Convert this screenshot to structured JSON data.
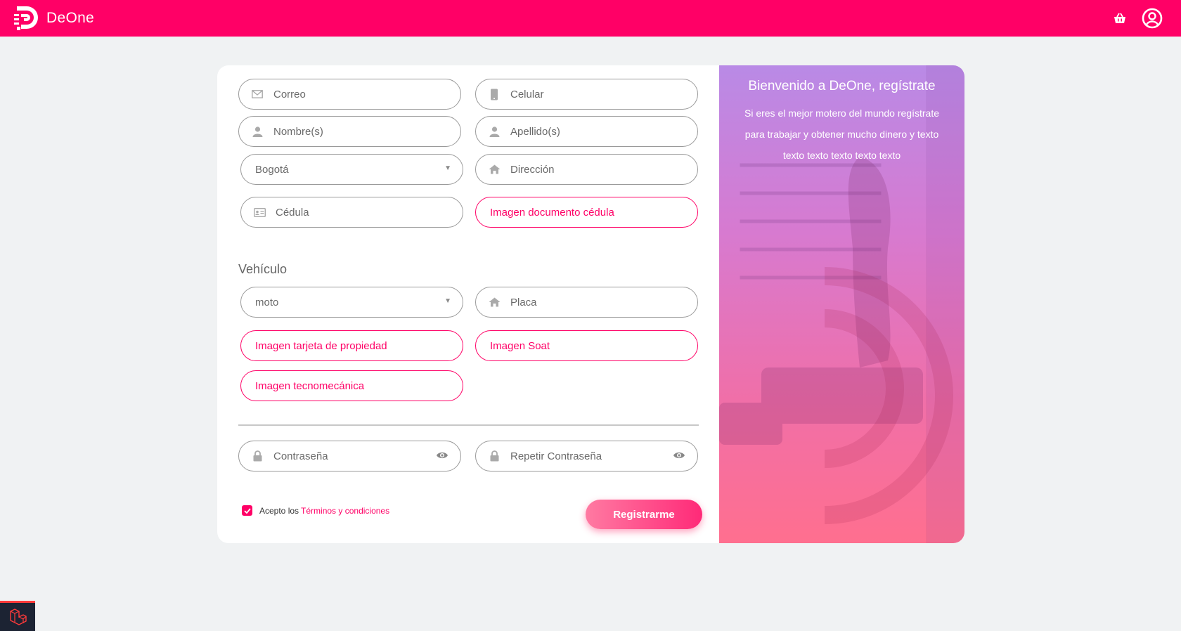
{
  "app": {
    "brand": "DeOne"
  },
  "colors": {
    "brand_pink": "#ff0066",
    "page_bg": "#f0f2f3"
  },
  "header": {
    "icons": [
      "basket-icon",
      "user-circle-icon"
    ]
  },
  "form": {
    "email_placeholder": "Correo",
    "phone_placeholder": "Celular",
    "name_placeholder": "Nombre(s)",
    "lastname_placeholder": "Apellido(s)",
    "city_selected": "Bogotá",
    "address_placeholder": "Dirección",
    "id_placeholder": "Cédula",
    "id_image_label": "Imagen documento cédula",
    "vehicle_section_title": "Vehículo",
    "vehicle_type_selected": "moto",
    "plate_placeholder": "Placa",
    "property_card_image_label": "Imagen tarjeta de propiedad",
    "soat_image_label": "Imagen Soat",
    "tech_image_label": "Imagen tecnomecánica",
    "password_placeholder": "Contraseña",
    "repeat_password_placeholder": "Repetir Contraseña",
    "terms_prefix": "Acepto los",
    "terms_link": "Términos y condiciones",
    "terms_checked": true,
    "submit_label": "Registrarme"
  },
  "welcome": {
    "title": "Bienvenido a DeOne, regístrate",
    "text": "Si eres el mejor motero del mundo regístrate para trabajar y obtener mucho dinero y texto texto texto texto texto texto"
  }
}
